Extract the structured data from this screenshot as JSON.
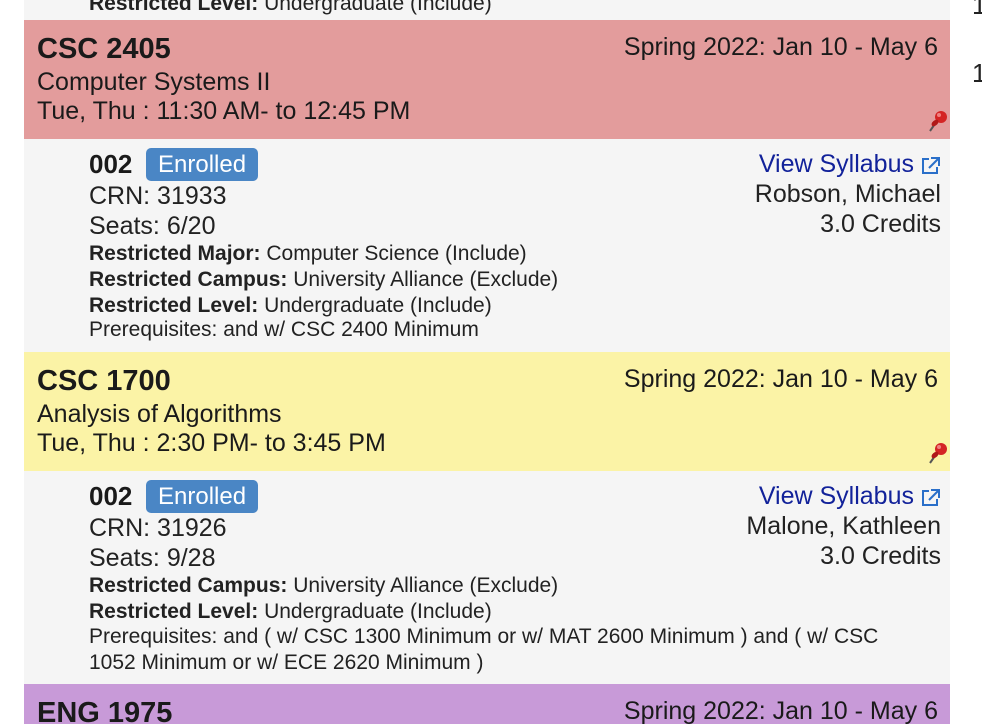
{
  "edge_marks": [
    "1",
    "1"
  ],
  "previous_section": {
    "restricted_level_label": "Restricted Level:",
    "restricted_level_value": "Undergraduate (Include)"
  },
  "courses": [
    {
      "code": "CSC 2405",
      "title": "Computer Systems II",
      "schedule": "Tue, Thu : 11:30 AM- to 12:45 PM",
      "term": "Spring 2022: Jan 10 - May 6",
      "header_color": "#e39c9c",
      "section": {
        "number": "002",
        "status": "Enrolled",
        "crn": "CRN: 31933",
        "seats": "Seats: 6/20",
        "syllabus_link": "View Syllabus",
        "instructor": "Robson, Michael",
        "credits": "3.0 Credits",
        "restrictions": [
          {
            "label": "Restricted Major:",
            "value": "Computer Science (Include)"
          },
          {
            "label": "Restricted Campus:",
            "value": "University Alliance (Exclude)"
          },
          {
            "label": "Restricted Level:",
            "value": "Undergraduate (Include)"
          }
        ],
        "prerequisites": "Prerequisites: and w/ CSC 2400 Minimum"
      }
    },
    {
      "code": "CSC 1700",
      "title": "Analysis of Algorithms",
      "schedule": "Tue, Thu : 2:30 PM- to 3:45 PM",
      "term": "Spring 2022: Jan 10 - May 6",
      "header_color": "#fbf3a6",
      "section": {
        "number": "002",
        "status": "Enrolled",
        "crn": "CRN: 31926",
        "seats": "Seats: 9/28",
        "syllabus_link": "View Syllabus",
        "instructor": "Malone, Kathleen",
        "credits": "3.0 Credits",
        "restrictions": [
          {
            "label": "Restricted Campus:",
            "value": "University Alliance (Exclude)"
          },
          {
            "label": "Restricted Level:",
            "value": "Undergraduate (Include)"
          }
        ],
        "prerequisites": "Prerequisites: and ( w/ CSC 1300 Minimum or w/ MAT 2600 Minimum ) and ( w/ CSC 1052 Minimum or w/ ECE 2620 Minimum )"
      }
    },
    {
      "code": "ENG 1975",
      "term": "Spring 2022: Jan 10 - May 6",
      "header_color": "#c89ad8"
    }
  ],
  "colors": {
    "badge": "#4a86c5",
    "link": "#12229a",
    "pin": "#d42424"
  }
}
